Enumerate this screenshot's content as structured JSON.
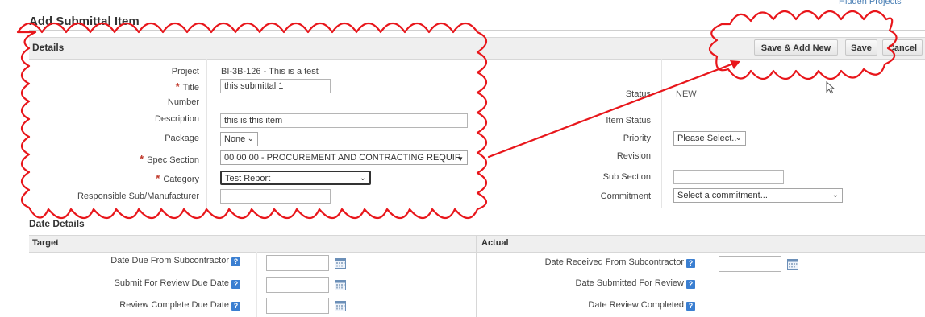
{
  "header": {
    "title": "Add Submittal Item",
    "hidden_projects": "Hidden Projects"
  },
  "details": {
    "section_title": "Details",
    "buttons": {
      "save_add_new": "Save & Add New",
      "save": "Save",
      "cancel": "Cancel"
    },
    "left_fields": {
      "project_label": "Project",
      "project_value": "BI-3B-126 - This is a test",
      "title_label": "Title",
      "title_value": "this submittal 1",
      "number_label": "Number",
      "description_label": "Description",
      "description_value": "this is this item",
      "package_label": "Package",
      "package_value": "None",
      "spec_section_label": "Spec Section",
      "spec_section_value": "00 00 00 - PROCUREMENT AND CONTRACTING REQUIR",
      "category_label": "Category",
      "category_value": "Test Report",
      "responsible_label": "Responsible Sub/Manufacturer",
      "responsible_value": ""
    },
    "right_fields": {
      "status_label": "Status",
      "status_value": "NEW",
      "item_status_label": "Item Status",
      "priority_label": "Priority",
      "priority_value": "Please Select..",
      "revision_label": "Revision",
      "sub_section_label": "Sub Section",
      "sub_section_value": "",
      "commitment_label": "Commitment",
      "commitment_value": "Select a commitment..."
    }
  },
  "date_details": {
    "section_title": "Date Details",
    "target_header": "Target",
    "actual_header": "Actual",
    "target_rows": [
      {
        "label": "Date Due From Subcontractor"
      },
      {
        "label": "Submit For Review Due Date"
      },
      {
        "label": "Review Complete Due Date"
      }
    ],
    "actual_rows": [
      {
        "label": "Date Received From Subcontractor"
      },
      {
        "label": "Date Submitted For Review"
      },
      {
        "label": "Date Review Completed"
      }
    ]
  },
  "icons": {
    "help": "help-icon",
    "calendar": "calendar-icon",
    "required": "required-star"
  },
  "colors": {
    "annotation": "#e8161b",
    "required": "#c0392b",
    "help": "#3b7fd1",
    "link": "#4a7fb5"
  }
}
